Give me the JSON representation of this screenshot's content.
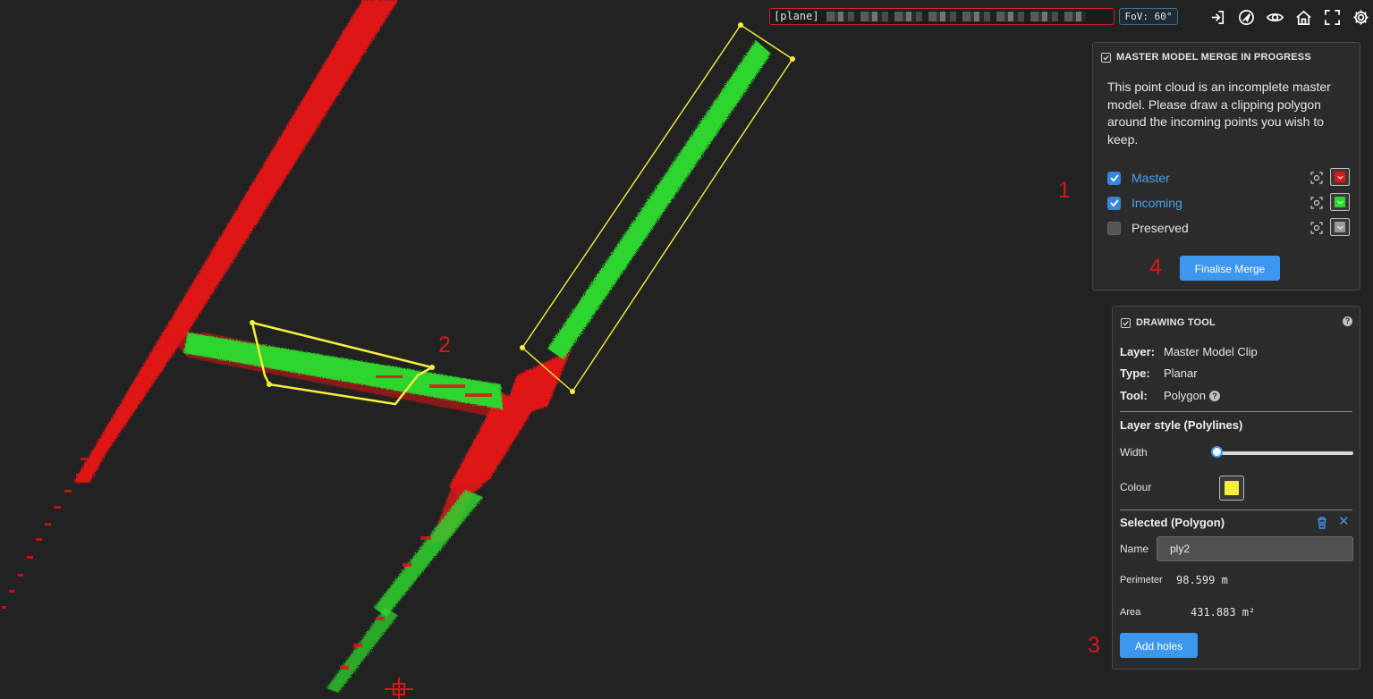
{
  "topbar": {
    "plane_label": "[plane]",
    "fov_label": "FoV: 60°",
    "icons": [
      "sign-in-icon",
      "navigate-icon",
      "eye-icon",
      "home-icon",
      "fullscreen-icon",
      "settings-icon"
    ]
  },
  "merge_panel": {
    "title": "MASTER MODEL MERGE IN PROGRESS",
    "description": "This point cloud is an incomplete master model. Please draw a clipping polygon around the incoming points you wish to keep.",
    "layers": [
      {
        "name": "Master",
        "checked": true,
        "color": "#e01515"
      },
      {
        "name": "Incoming",
        "checked": true,
        "color": "#2fd52f"
      },
      {
        "name": "Preserved",
        "checked": false,
        "color": "#9a9a9a"
      }
    ],
    "finalise_label": "Finalise Merge"
  },
  "drawing_panel": {
    "title": "DRAWING TOOL",
    "layer_key": "Layer:",
    "layer_value": "Master Model Clip",
    "type_key": "Type:",
    "type_value": "Planar",
    "tool_key": "Tool:",
    "tool_value": "Polygon",
    "style_heading": "Layer style (Polylines)",
    "width_label": "Width",
    "width_value": 0,
    "colour_label": "Colour",
    "colour_value": "#f5f03a",
    "selected_heading": "Selected (Polygon)",
    "name_label": "Name",
    "name_value": "ply2",
    "perimeter_label": "Perimeter",
    "perimeter_value": "98.599 m",
    "area_label": "Area",
    "area_value": "431.883 m²",
    "add_holes_label": "Add holes"
  },
  "annotations": [
    "1",
    "2",
    "3",
    "4"
  ],
  "colors": {
    "accent": "#3d97ef",
    "master": "#e01515",
    "incoming": "#2fd52f",
    "polygon": "#f5f03a",
    "background": "#222222"
  }
}
